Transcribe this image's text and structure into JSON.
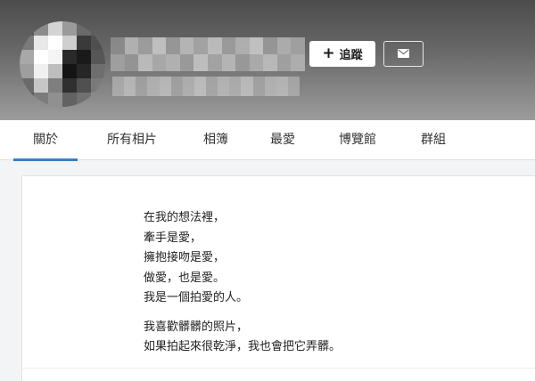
{
  "profile": {
    "follow_label": "追蹤",
    "follow_icon": "plus-icon",
    "message_icon": "envelope-icon"
  },
  "tabs": [
    {
      "label": "關於",
      "active": true
    },
    {
      "label": "所有相片",
      "active": false
    },
    {
      "label": "相簿",
      "active": false
    },
    {
      "label": "最愛",
      "active": false
    },
    {
      "label": "博覽館",
      "active": false
    },
    {
      "label": "群組",
      "active": false
    }
  ],
  "about": {
    "paragraph1": [
      "在我的想法裡，",
      "牽手是愛，",
      "擁抱接吻是愛，",
      "做愛，也是愛。",
      "我是一個拍愛的人。"
    ],
    "paragraph2": [
      "我喜歡髒髒的照片，",
      "如果拍起來很乾淨，我也會把它弄髒。"
    ]
  },
  "colors": {
    "accent": "#3a7fc3",
    "header_dark": "#4c4c4c",
    "header_light": "#9c9c9c"
  }
}
